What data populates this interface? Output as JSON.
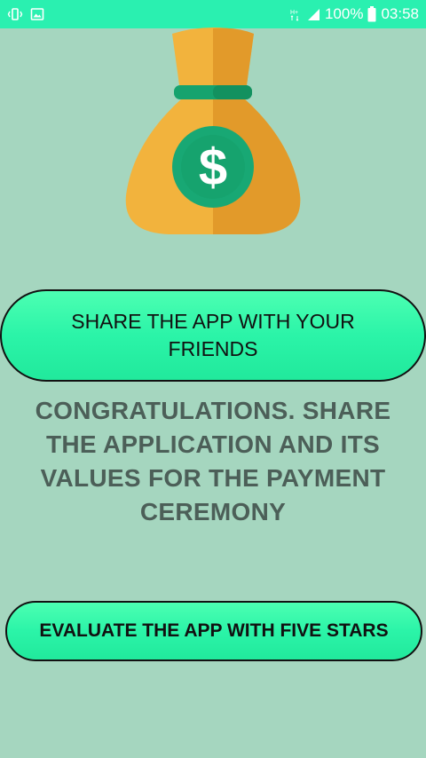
{
  "status_bar": {
    "battery_text": "100%",
    "time": "03:58",
    "signal_label": "H+",
    "icons": [
      "vibrate-icon",
      "image-icon",
      "network-type-icon",
      "signal-icon",
      "battery-icon"
    ]
  },
  "hero": {
    "icon": "money-bag-icon",
    "symbol": "$",
    "colors": {
      "bag": "#f2b33d",
      "bag_shadow": "#e29a2a",
      "band": "#16a36e",
      "coin": "#18a874"
    }
  },
  "buttons": {
    "share_label": "SHARE THE APP WITH YOUR FRIENDS",
    "evaluate_label": "EVALUATE THE APP WITH FIVE STARS"
  },
  "message": "CONGRATULATIONS. SHARE THE APPLICATION AND ITS VALUES FOR THE PAYMENT CEREMONY",
  "colors": {
    "background": "#a5d6bf",
    "status_bar": "#2af0b0",
    "button": "#2bf4a8",
    "message_text": "#4c5f58"
  }
}
